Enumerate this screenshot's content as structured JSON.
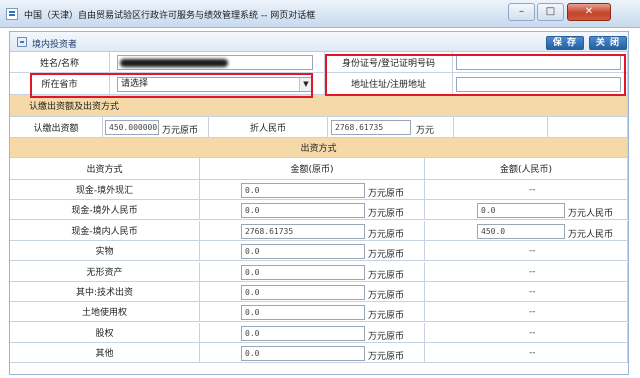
{
  "window": {
    "title": "中国（天津）自由贸易试验区行政许可服务与绩效管理系统 -- 网页对话框",
    "min_label": "–",
    "max_label": "□",
    "close_label": "✕"
  },
  "panel": {
    "title": "境内投资者",
    "save_label": "保 存",
    "close_label": "关 闭"
  },
  "form": {
    "name_label": "姓名/名称",
    "id_label": "身份证号/登记证明号码",
    "province_label": "所在省市",
    "province_value": "请选择",
    "address_label": "地址住址/注册地址"
  },
  "subscription": {
    "section_title": "认缴出资额及出资方式",
    "amount_label": "认缴出资额",
    "amount_value": "450.000000",
    "amount_unit": "万元原币",
    "rmb_label": "折人民币",
    "rmb_value": "2768.61735",
    "rmb_unit": "万元"
  },
  "methods": {
    "section_title": "出资方式",
    "headers": [
      "出资方式",
      "金额(原币)",
      "金额(人民币)"
    ],
    "orig_unit": "万元原币",
    "rmb_unit": "万元人民币",
    "rows": [
      {
        "name": "现金-境外现汇",
        "orig": "0.0",
        "rmb": "--"
      },
      {
        "name": "现金-境外人民币",
        "orig": "0.0",
        "rmb": "0.0"
      },
      {
        "name": "现金-境内人民币",
        "orig": "2768.61735",
        "rmb": "450.0"
      },
      {
        "name": "实物",
        "orig": "0.0",
        "rmb": "--"
      },
      {
        "name": "无形资产",
        "orig": "0.0",
        "rmb": "--"
      },
      {
        "name": "其中:技术出资",
        "orig": "0.0",
        "rmb": "--"
      },
      {
        "name": "土地使用权",
        "orig": "0.0",
        "rmb": "--"
      },
      {
        "name": "股权",
        "orig": "0.0",
        "rmb": "--"
      },
      {
        "name": "其他",
        "orig": "0.0",
        "rmb": "--"
      }
    ]
  },
  "colors": {
    "section_band": "#f6d9a8",
    "highlight_box": "#e1162b",
    "button_blue": "#23609f"
  }
}
